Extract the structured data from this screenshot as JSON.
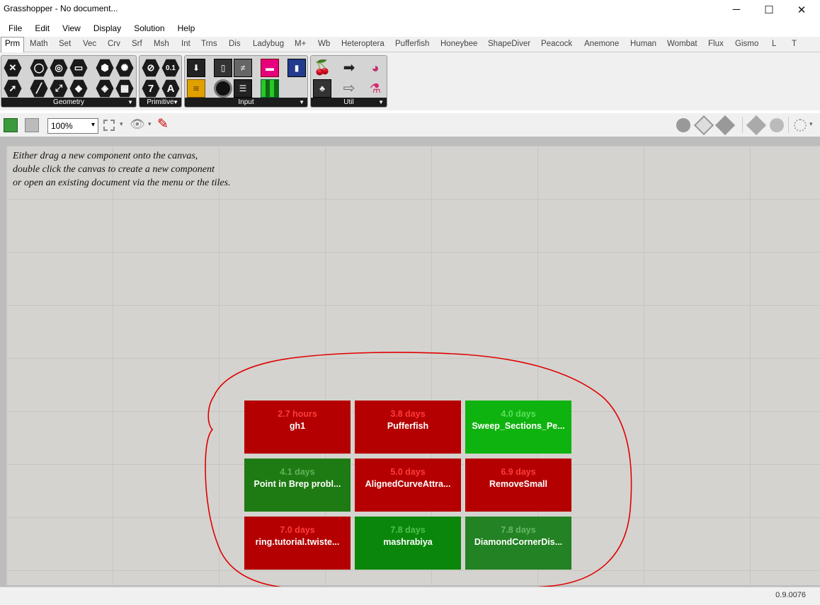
{
  "window": {
    "title": "Grasshopper - No document...",
    "minimize": "─",
    "maximize": "☐",
    "close": "✕"
  },
  "menu": [
    "File",
    "Edit",
    "View",
    "Display",
    "Solution",
    "Help"
  ],
  "tabs": [
    "Prm",
    "Math",
    "Set",
    "Vec",
    "Crv",
    "Srf",
    "Msh",
    "Int",
    "Trns",
    "Dis",
    "Ladybug",
    "M+",
    "Wb",
    "Heteroptera",
    "Pufferfish",
    "Honeybee",
    "ShapeDiver",
    "Peacock",
    "Anemone",
    "Human",
    "Wombat",
    "Flux",
    "Gismo",
    "L",
    "T"
  ],
  "active_tab": "Prm",
  "ribbon": {
    "panels": [
      {
        "label": "Geometry"
      },
      {
        "label": "Primitive"
      },
      {
        "label": "Input"
      },
      {
        "label": "Util"
      }
    ],
    "primitive_glyphs": [
      "0.1",
      "7",
      "A"
    ]
  },
  "toolbar": {
    "zoom_value": "100%"
  },
  "canvas": {
    "hint_lines": [
      "Either drag a new component onto the canvas,",
      "double click the canvas to create a new component",
      "or open an existing document via the menu or the tiles."
    ]
  },
  "tiles": [
    {
      "age": "2.7 hours",
      "name": "gh1",
      "bg": "#b40000",
      "age_color": "#ff3a3a"
    },
    {
      "age": "3.8 days",
      "name": "Pufferfish",
      "bg": "#b40000",
      "age_color": "#ff3a3a"
    },
    {
      "age": "4.0 days",
      "name": "Sweep_Sections_Pe...",
      "bg": "#0fb30f",
      "age_color": "#5be05b"
    },
    {
      "age": "4.1 days",
      "name": "Point in Brep probl...",
      "bg": "#1e7a12",
      "age_color": "#5fb35a"
    },
    {
      "age": "5.0 days",
      "name": "AlignedCurveAttra...",
      "bg": "#b40000",
      "age_color": "#ff3a3a"
    },
    {
      "age": "6.9 days",
      "name": "RemoveSmall",
      "bg": "#b40000",
      "age_color": "#ff3a3a"
    },
    {
      "age": "7.0 days",
      "name": "ring.tutorial.twiste...",
      "bg": "#b40000",
      "age_color": "#ff3a3a"
    },
    {
      "age": "7.8 days",
      "name": "mashrabiya",
      "bg": "#0a870a",
      "age_color": "#4fc04f"
    },
    {
      "age": "7.8 days",
      "name": "DiamondCornerDis...",
      "bg": "#238223",
      "age_color": "#66b866"
    }
  ],
  "status": {
    "version": "0.9.0076"
  },
  "colors": {
    "annotation": "#e00000",
    "canvas": "#d4d3cf"
  }
}
